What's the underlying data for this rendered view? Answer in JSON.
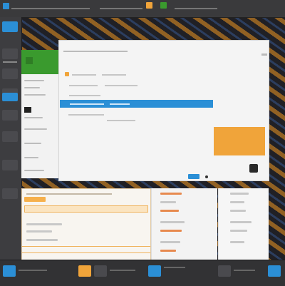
{
  "colors": {
    "accent": "#2b8fd6",
    "brand_green": "#3a9a2e",
    "warning_orange": "#f0a43a",
    "dock_background": "#3d3d40"
  },
  "icons": [
    "windows-start-icon",
    "folder-icon",
    "settings-icon",
    "search-icon",
    "app-tile-icon"
  ],
  "topbar": {
    "title": ""
  },
  "sidebar": {
    "header_title": "",
    "items": [
      "",
      "",
      "",
      "",
      "",
      "",
      "",
      ""
    ]
  },
  "dialog": {
    "title": "",
    "rows": [
      "",
      "",
      "",
      "",
      ""
    ],
    "selected_row": "",
    "ok_label": ""
  },
  "bottom": {
    "left_title": "",
    "mid_title": "",
    "right_title": ""
  },
  "taskbar": {
    "items": [
      "",
      "",
      "",
      "",
      ""
    ]
  }
}
